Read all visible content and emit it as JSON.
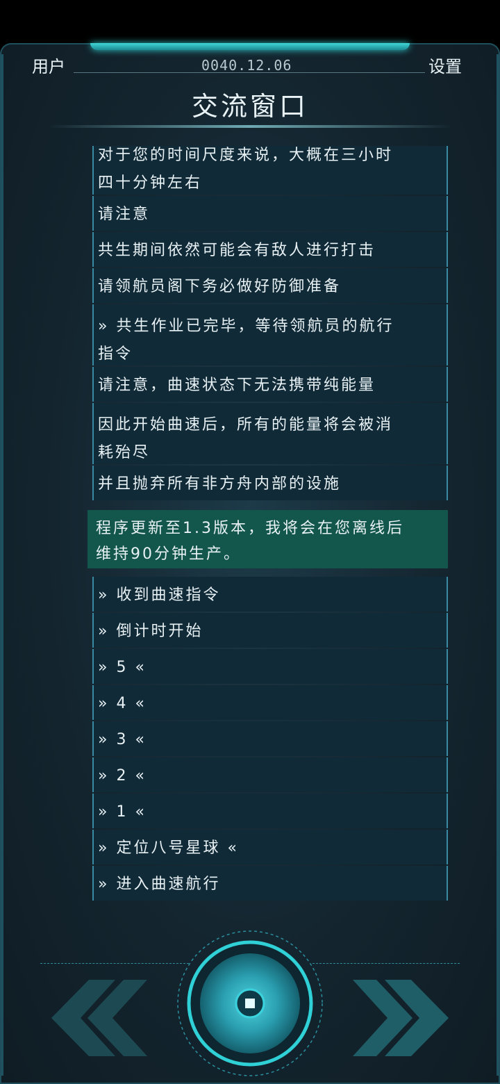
{
  "header": {
    "user_label": "用户",
    "date": "0040.12.06",
    "settings_label": "设置",
    "title": "交流窗口"
  },
  "messages": [
    {
      "line1": "对于您的时间尺度来说，大概在三小时",
      "line2": "四十分钟左右"
    },
    {
      "text": "请注意"
    },
    {
      "text": "共生期间依然可能会有敌人进行打击"
    },
    {
      "text": "请领航员阁下务必做好防御准备"
    },
    {
      "line1": "» 共生作业已完毕，等待领航员的航行",
      "line2": "指令"
    },
    {
      "text": "请注意，曲速状态下无法携带纯能量"
    },
    {
      "line1": "因此开始曲速后，所有的能量将会被消",
      "line2": "耗殆尽"
    },
    {
      "text": "并且抛弃所有非方舟内部的设施"
    },
    {
      "line1": "程序更新至1.3版本，我将会在您离线后",
      "line2": "维持90分钟生产。"
    },
    {
      "text": "» 收到曲速指令"
    },
    {
      "text": "» 倒计时开始"
    },
    {
      "text": "» 5 «"
    },
    {
      "text": "» 4 «"
    },
    {
      "text": "» 3 «"
    },
    {
      "text": "» 2 «"
    },
    {
      "text": "» 1 «"
    },
    {
      "text": "» 定位八号星球 «"
    },
    {
      "text": "» 进入曲速航行"
    }
  ],
  "controls": {
    "prev_icon": "double-chevron-left-icon",
    "next_icon": "double-chevron-right-icon",
    "center_icon": "stop-square-icon"
  },
  "colors": {
    "accent": "#2fc6c6",
    "message_bg": "#112a38",
    "message_border": "#3b8aa4",
    "highlight_bg": "#13564c"
  }
}
